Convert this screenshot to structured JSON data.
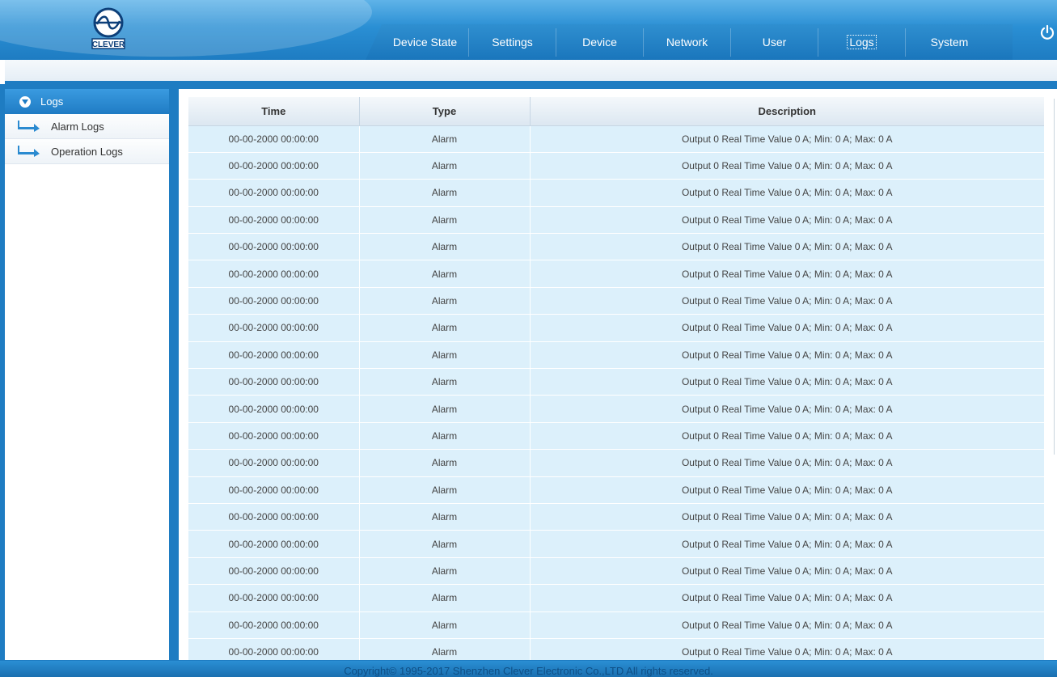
{
  "brand": {
    "logo_text": "CLEVER"
  },
  "nav": {
    "tabs": [
      {
        "label": "Device State"
      },
      {
        "label": "Settings"
      },
      {
        "label": "Device"
      },
      {
        "label": "Network"
      },
      {
        "label": "User"
      },
      {
        "label": "Logs",
        "active": true
      },
      {
        "label": "System"
      }
    ],
    "power_icon": "power-icon"
  },
  "sidebar": {
    "header": "Logs",
    "items": [
      {
        "label": "Alarm Logs",
        "icon": "arrow-icon"
      },
      {
        "label": "Operation Logs",
        "icon": "arrow-icon"
      }
    ]
  },
  "table": {
    "columns": [
      "Time",
      "Type",
      "Description"
    ],
    "rows": [
      [
        "00-00-2000 00:00:00",
        "Alarm",
        "Output 0 Real Time Value 0 A; Min: 0 A; Max: 0 A"
      ],
      [
        "00-00-2000 00:00:00",
        "Alarm",
        "Output 0 Real Time Value 0 A; Min: 0 A; Max: 0 A"
      ],
      [
        "00-00-2000 00:00:00",
        "Alarm",
        "Output 0 Real Time Value 0 A; Min: 0 A; Max: 0 A"
      ],
      [
        "00-00-2000 00:00:00",
        "Alarm",
        "Output 0 Real Time Value 0 A; Min: 0 A; Max: 0 A"
      ],
      [
        "00-00-2000 00:00:00",
        "Alarm",
        "Output 0 Real Time Value 0 A; Min: 0 A; Max: 0 A"
      ],
      [
        "00-00-2000 00:00:00",
        "Alarm",
        "Output 0 Real Time Value 0 A; Min: 0 A; Max: 0 A"
      ],
      [
        "00-00-2000 00:00:00",
        "Alarm",
        "Output 0 Real Time Value 0 A; Min: 0 A; Max: 0 A"
      ],
      [
        "00-00-2000 00:00:00",
        "Alarm",
        "Output 0 Real Time Value 0 A; Min: 0 A; Max: 0 A"
      ],
      [
        "00-00-2000 00:00:00",
        "Alarm",
        "Output 0 Real Time Value 0 A; Min: 0 A; Max: 0 A"
      ],
      [
        "00-00-2000 00:00:00",
        "Alarm",
        "Output 0 Real Time Value 0 A; Min: 0 A; Max: 0 A"
      ],
      [
        "00-00-2000 00:00:00",
        "Alarm",
        "Output 0 Real Time Value 0 A; Min: 0 A; Max: 0 A"
      ],
      [
        "00-00-2000 00:00:00",
        "Alarm",
        "Output 0 Real Time Value 0 A; Min: 0 A; Max: 0 A"
      ],
      [
        "00-00-2000 00:00:00",
        "Alarm",
        "Output 0 Real Time Value 0 A; Min: 0 A; Max: 0 A"
      ],
      [
        "00-00-2000 00:00:00",
        "Alarm",
        "Output 0 Real Time Value 0 A; Min: 0 A; Max: 0 A"
      ],
      [
        "00-00-2000 00:00:00",
        "Alarm",
        "Output 0 Real Time Value 0 A; Min: 0 A; Max: 0 A"
      ],
      [
        "00-00-2000 00:00:00",
        "Alarm",
        "Output 0 Real Time Value 0 A; Min: 0 A; Max: 0 A"
      ],
      [
        "00-00-2000 00:00:00",
        "Alarm",
        "Output 0 Real Time Value 0 A; Min: 0 A; Max: 0 A"
      ],
      [
        "00-00-2000 00:00:00",
        "Alarm",
        "Output 0 Real Time Value 0 A; Min: 0 A; Max: 0 A"
      ],
      [
        "00-00-2000 00:00:00",
        "Alarm",
        "Output 0 Real Time Value 0 A; Min: 0 A; Max: 0 A"
      ],
      [
        "00-00-2000 00:00:00",
        "Alarm",
        "Output 0 Real Time Value 0 A; Min: 0 A; Max: 0 A"
      ]
    ]
  },
  "footer": {
    "copyright": "Copyright© 1995-2017 Shenzhen Clever Electronic Co.,LTD All rights reserved."
  },
  "colors": {
    "primary": "#1e7cc2",
    "row_bg": "#dcf0fb",
    "header_light": "#5fb3e8"
  }
}
